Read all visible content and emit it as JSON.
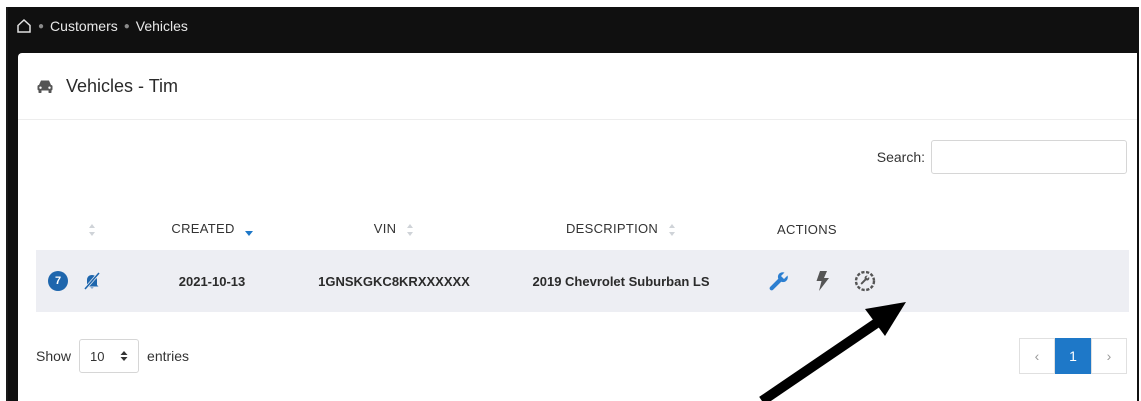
{
  "breadcrumb": [
    "Customers",
    "Vehicles"
  ],
  "card": {
    "title": "Vehicles - Tim"
  },
  "search": {
    "label": "Search:",
    "value": ""
  },
  "table": {
    "headers": [
      "",
      "CREATED",
      "VIN",
      "DESCRIPTION",
      "ACTIONS"
    ],
    "rows": [
      {
        "badge": "7",
        "created": "2021-10-13",
        "vin": "1GNSKGKC8KRXXXXXX",
        "description": "2019 Chevrolet Suburban LS"
      }
    ]
  },
  "length": {
    "show": "Show",
    "value": "10",
    "entries": "entries"
  },
  "pagination": {
    "prev": "‹",
    "page": "1",
    "next": "›"
  },
  "colors": {
    "accent": "#1e78c8",
    "wrench": "#2c7fd1",
    "row_bg": "#edeef3"
  },
  "icons": [
    "home-icon",
    "car-icon",
    "bell-slash-icon",
    "wrench-icon",
    "bolt-icon",
    "gear-wrench-icon"
  ]
}
